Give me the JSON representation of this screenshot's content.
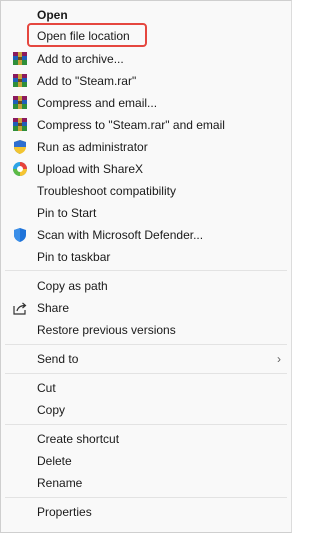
{
  "menu": {
    "items": [
      {
        "label": "Open",
        "icon": null,
        "bold": true
      },
      {
        "label": "Open file location",
        "icon": null
      },
      {
        "label": "Add to archive...",
        "icon": "winrar-icon"
      },
      {
        "label": "Add to \"Steam.rar\"",
        "icon": "winrar-icon"
      },
      {
        "label": "Compress and email...",
        "icon": "winrar-icon"
      },
      {
        "label": "Compress to \"Steam.rar\" and email",
        "icon": "winrar-icon"
      },
      {
        "label": "Run as administrator",
        "icon": "shield-uac-icon"
      },
      {
        "label": "Upload with ShareX",
        "icon": "sharex-icon"
      },
      {
        "label": "Troubleshoot compatibility",
        "icon": null
      },
      {
        "label": "Pin to Start",
        "icon": null
      },
      {
        "label": "Scan with Microsoft Defender...",
        "icon": "defender-shield-icon"
      },
      {
        "label": "Pin to taskbar",
        "icon": null
      },
      {
        "label": "Copy as path",
        "icon": null
      },
      {
        "label": "Share",
        "icon": "share-icon"
      },
      {
        "label": "Restore previous versions",
        "icon": null
      },
      {
        "label": "Send to",
        "icon": null,
        "submenu": true
      },
      {
        "label": "Cut",
        "icon": null
      },
      {
        "label": "Copy",
        "icon": null
      },
      {
        "label": "Create shortcut",
        "icon": null
      },
      {
        "label": "Delete",
        "icon": null
      },
      {
        "label": "Rename",
        "icon": null
      },
      {
        "label": "Properties",
        "icon": null
      }
    ],
    "highlighted_item": "Open file location",
    "highlight_color": "#e5473f"
  }
}
